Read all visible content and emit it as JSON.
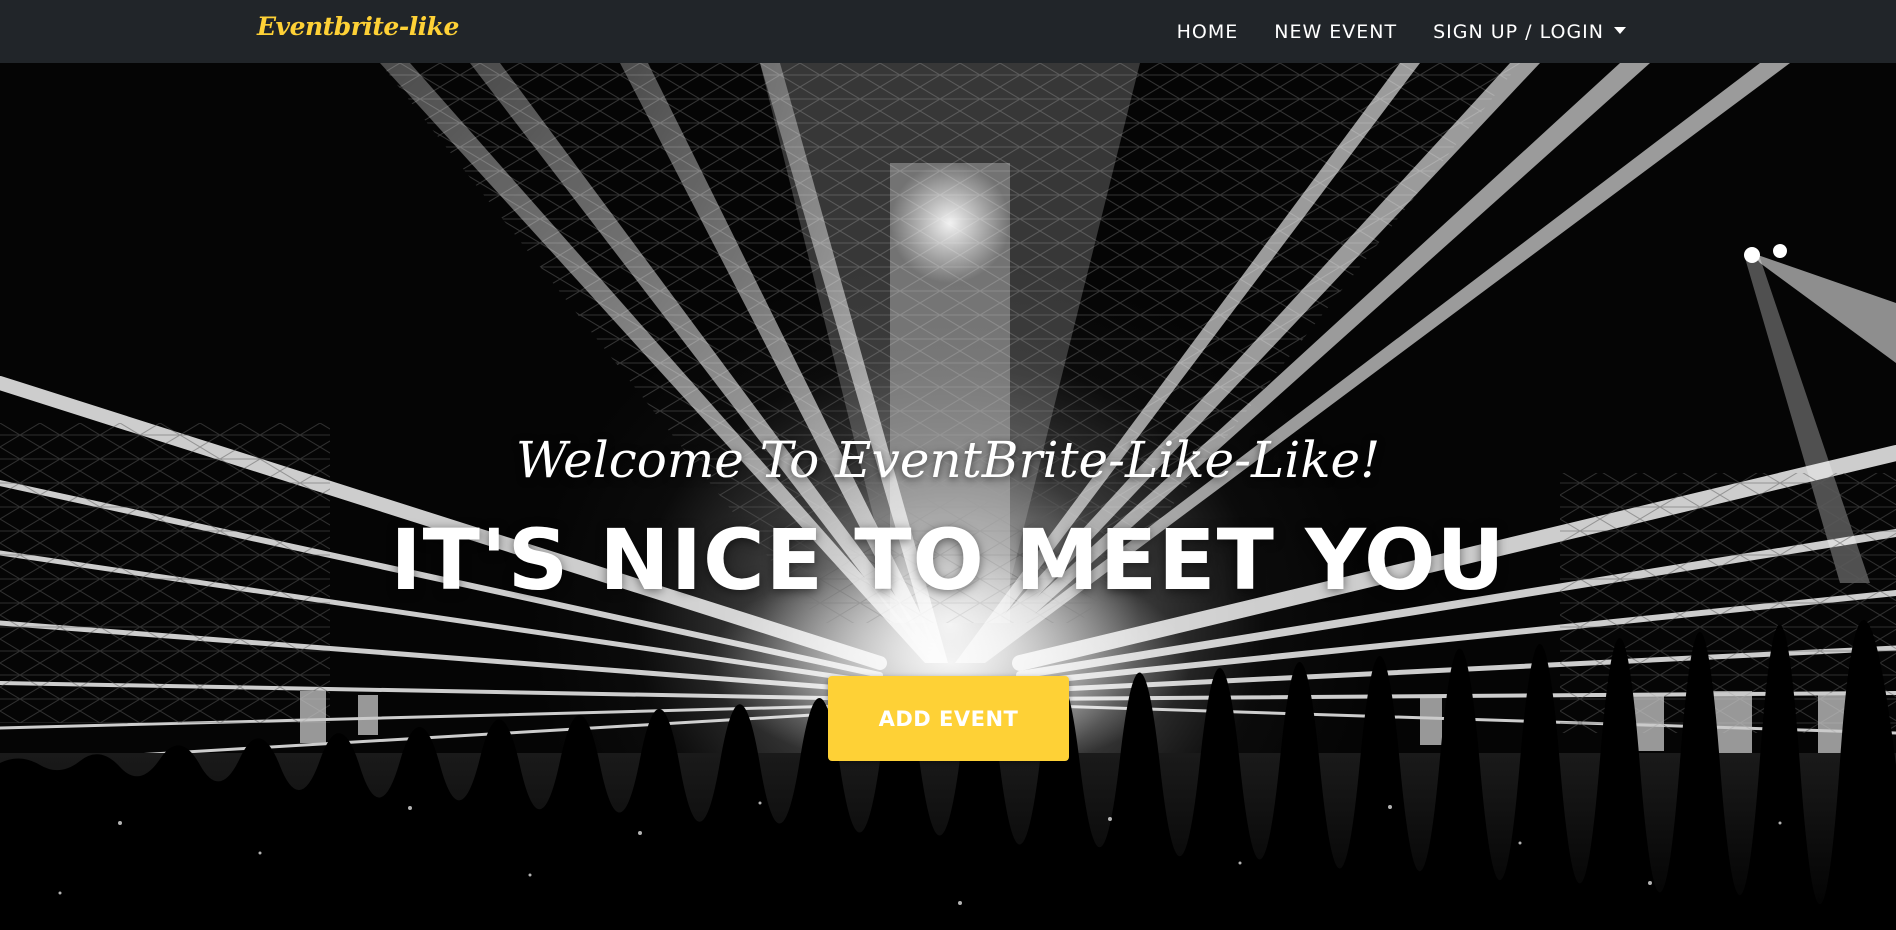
{
  "navbar": {
    "brand": "Eventbrite-like",
    "links": [
      {
        "label": "HOME"
      },
      {
        "label": "NEW EVENT"
      },
      {
        "label": "SIGN UP / LOGIN"
      }
    ],
    "dropdown_icon": "caret-down-icon",
    "background_color": "#212529",
    "brand_color": "#fed136"
  },
  "hero": {
    "welcome": "Welcome To EventBrite-Like-Like!",
    "headline": "IT'S NICE TO MEET YOU",
    "cta_label": "ADD EVENT",
    "cta_color": "#fed136",
    "background_image": "black-and-white concert arena with light beams and crowd"
  }
}
